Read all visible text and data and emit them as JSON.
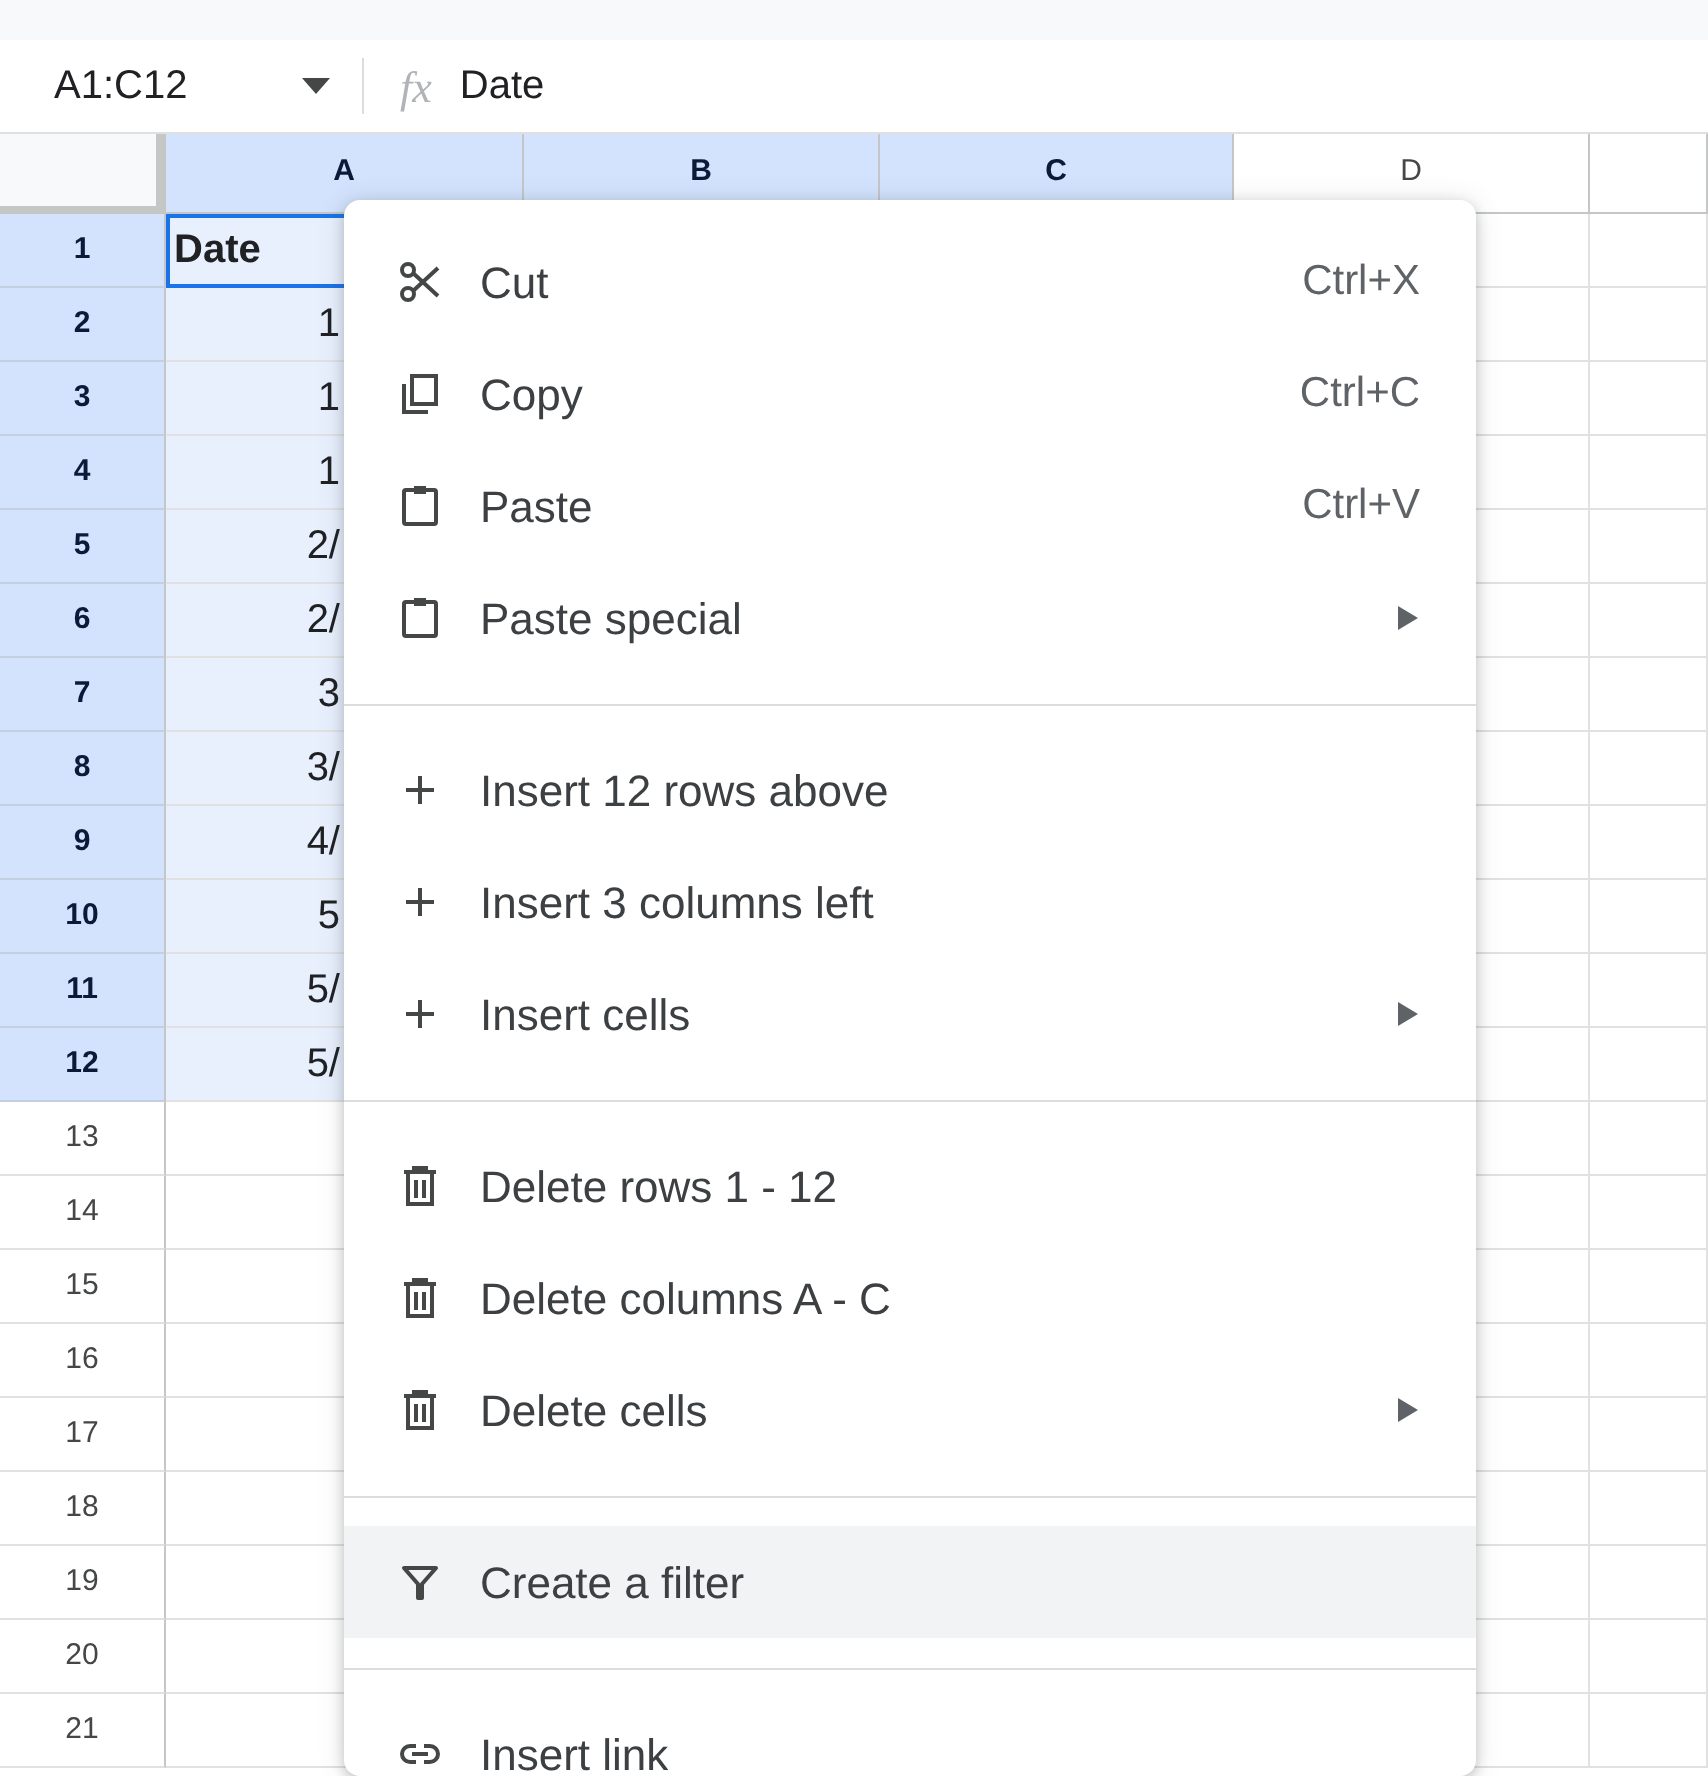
{
  "name_box": {
    "value": "A1:C12"
  },
  "formula_bar": {
    "icon_label": "fx",
    "value": "Date"
  },
  "columns": [
    {
      "label": "A",
      "selected": true
    },
    {
      "label": "B",
      "selected": true
    },
    {
      "label": "C",
      "selected": true
    },
    {
      "label": "D",
      "selected": false
    }
  ],
  "rows": [
    {
      "label": "1",
      "selected": true,
      "cells": [
        "Date"
      ]
    },
    {
      "label": "2",
      "selected": true,
      "cells": [
        "1"
      ]
    },
    {
      "label": "3",
      "selected": true,
      "cells": [
        "1"
      ]
    },
    {
      "label": "4",
      "selected": true,
      "cells": [
        "1"
      ]
    },
    {
      "label": "5",
      "selected": true,
      "cells": [
        "2/"
      ]
    },
    {
      "label": "6",
      "selected": true,
      "cells": [
        "2/"
      ]
    },
    {
      "label": "7",
      "selected": true,
      "cells": [
        "3"
      ]
    },
    {
      "label": "8",
      "selected": true,
      "cells": [
        "3/"
      ]
    },
    {
      "label": "9",
      "selected": true,
      "cells": [
        "4/"
      ]
    },
    {
      "label": "10",
      "selected": true,
      "cells": [
        "5"
      ]
    },
    {
      "label": "11",
      "selected": true,
      "cells": [
        "5/"
      ]
    },
    {
      "label": "12",
      "selected": true,
      "cells": [
        "5/"
      ]
    },
    {
      "label": "13",
      "selected": false,
      "cells": []
    },
    {
      "label": "14",
      "selected": false,
      "cells": []
    },
    {
      "label": "15",
      "selected": false,
      "cells": []
    },
    {
      "label": "16",
      "selected": false,
      "cells": []
    },
    {
      "label": "17",
      "selected": false,
      "cells": []
    },
    {
      "label": "18",
      "selected": false,
      "cells": []
    },
    {
      "label": "19",
      "selected": false,
      "cells": []
    },
    {
      "label": "20",
      "selected": false,
      "cells": []
    },
    {
      "label": "21",
      "selected": false,
      "cells": []
    }
  ],
  "context_menu": {
    "sections": [
      [
        {
          "kind": "cut",
          "label": "Cut",
          "shortcut": "Ctrl+X",
          "submenu": false,
          "highlighted": false
        },
        {
          "kind": "copy",
          "label": "Copy",
          "shortcut": "Ctrl+C",
          "submenu": false,
          "highlighted": false
        },
        {
          "kind": "paste",
          "label": "Paste",
          "shortcut": "Ctrl+V",
          "submenu": false,
          "highlighted": false
        },
        {
          "kind": "paste",
          "label": "Paste special",
          "submenu": true,
          "highlighted": false
        }
      ],
      [
        {
          "kind": "insert",
          "label": "Insert 12 rows above",
          "submenu": false,
          "highlighted": false
        },
        {
          "kind": "insert",
          "label": "Insert 3 columns left",
          "submenu": false,
          "highlighted": false
        },
        {
          "kind": "insert",
          "label": "Insert cells",
          "submenu": true,
          "highlighted": false
        }
      ],
      [
        {
          "kind": "delete",
          "label": "Delete rows 1 - 12",
          "submenu": false,
          "highlighted": false
        },
        {
          "kind": "delete",
          "label": "Delete columns A - C",
          "submenu": false,
          "highlighted": false
        },
        {
          "kind": "delete",
          "label": "Delete cells",
          "submenu": true,
          "highlighted": false
        }
      ],
      [
        {
          "kind": "filter",
          "label": "Create a filter",
          "submenu": false,
          "highlighted": true
        }
      ],
      [
        {
          "kind": "link",
          "label": "Insert link",
          "submenu": false,
          "highlighted": false
        }
      ]
    ]
  }
}
